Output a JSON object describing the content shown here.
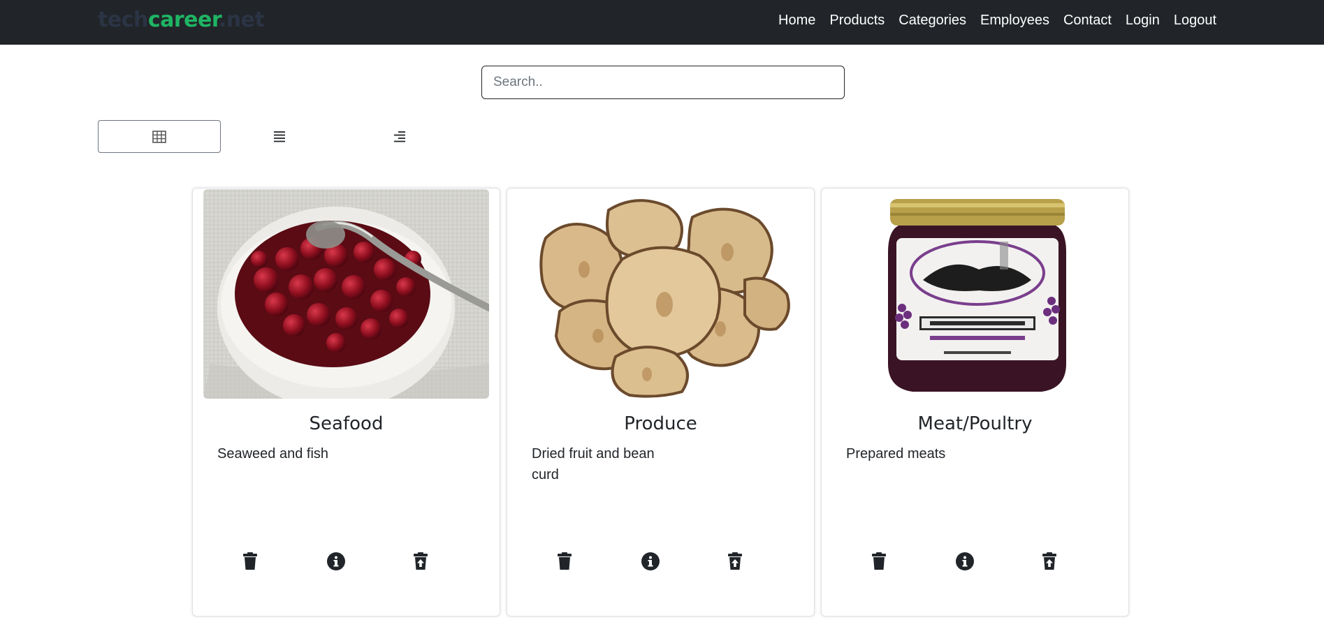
{
  "header": {
    "brand": {
      "part1": "tech",
      "part2": "career",
      "part3": ".net"
    },
    "nav": [
      "Home",
      "Products",
      "Categories",
      "Employees",
      "Contact",
      "Login",
      "Logout"
    ]
  },
  "search": {
    "placeholder": "Search..",
    "value": ""
  },
  "view_toggles": [
    {
      "icon": "grid-icon",
      "active": true
    },
    {
      "icon": "list-icon",
      "active": false
    },
    {
      "icon": "align-right-icon",
      "active": false
    }
  ],
  "cards": [
    {
      "title": "Seafood",
      "description": "Seaweed and fish",
      "image": "cranberry-bowl-image"
    },
    {
      "title": "Produce",
      "description": "Dried fruit and bean curd",
      "image": "dried-pears-image"
    },
    {
      "title": "Meat/Poultry",
      "description": "Prepared meats",
      "image": "jam-jar-image"
    }
  ],
  "card_actions": [
    "trash-icon",
    "info-icon",
    "trash-restore-icon"
  ],
  "colors": {
    "navbar": "#212529",
    "brand_accent": "#1fb564",
    "brand_dark": "#2b3444"
  }
}
